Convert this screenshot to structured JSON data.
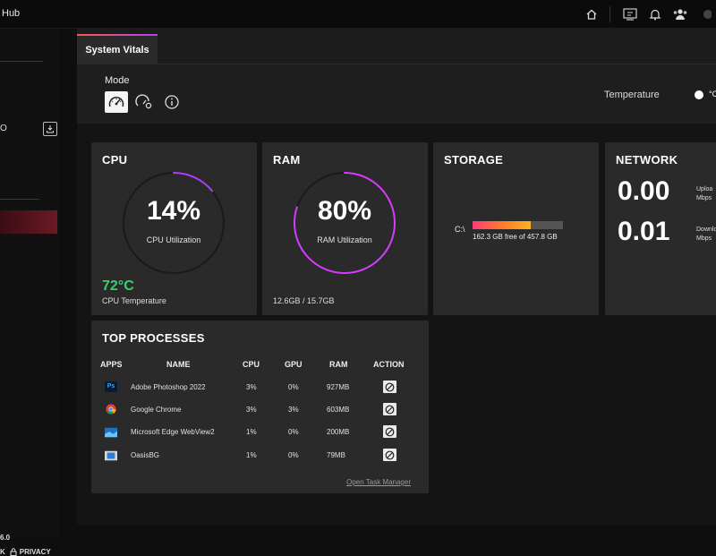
{
  "titlebar": {
    "app_title": "Hub"
  },
  "sidebar": {
    "version": "6.0",
    "footer_left": "K",
    "privacy": "PRIVACY",
    "partial_label": "O"
  },
  "tab": {
    "label": "System Vitals"
  },
  "mode": {
    "label": "Mode",
    "buttons": [
      "speedometer-icon",
      "gauge-settings-icon",
      "info-icon"
    ]
  },
  "temperature": {
    "label": "Temperature",
    "unit": "°C"
  },
  "cpu": {
    "title": "CPU",
    "value": "14%",
    "percent": 14,
    "sub": "CPU Utilization",
    "temp": "72°C",
    "temp_label": "CPU Temperature",
    "ring_color": "#b43cff"
  },
  "ram": {
    "title": "RAM",
    "value": "80%",
    "percent": 80,
    "sub": "RAM Utilization",
    "usage": "12.6GB / 15.7GB",
    "ring_color": "#d63cff"
  },
  "storage": {
    "title": "STORAGE",
    "drive": "C:\\",
    "used_fraction": 0.645,
    "free_text": "162.3 GB free of 457.8 GB"
  },
  "network": {
    "title": "NETWORK",
    "upload_value": "0.00",
    "upload_label": "Uploa",
    "upload_unit": "Mbps",
    "download_value": "0.01",
    "download_label": "Downlo",
    "download_unit": "Mbps"
  },
  "processes": {
    "title": "TOP PROCESSES",
    "headers": {
      "apps": "APPS",
      "name": "NAME",
      "cpu": "CPU",
      "gpu": "GPU",
      "ram": "RAM",
      "action": "ACTION"
    },
    "rows": [
      {
        "icon": "photoshop-icon",
        "icon_text": "Ps",
        "name": "Adobe Photoshop 2022",
        "cpu": "3%",
        "gpu": "0%",
        "ram": "927MB"
      },
      {
        "icon": "chrome-icon",
        "icon_text": "",
        "name": "Google Chrome",
        "cpu": "3%",
        "gpu": "3%",
        "ram": "603MB"
      },
      {
        "icon": "edge-webview-icon",
        "icon_text": "",
        "name": "Microsoft Edge WebView2",
        "cpu": "1%",
        "gpu": "0%",
        "ram": "200MB"
      },
      {
        "icon": "oasisbg-icon",
        "icon_text": "",
        "name": "OasisBG",
        "cpu": "1%",
        "gpu": "0%",
        "ram": "79MB"
      }
    ],
    "task_manager_link": "Open Task Manager"
  }
}
